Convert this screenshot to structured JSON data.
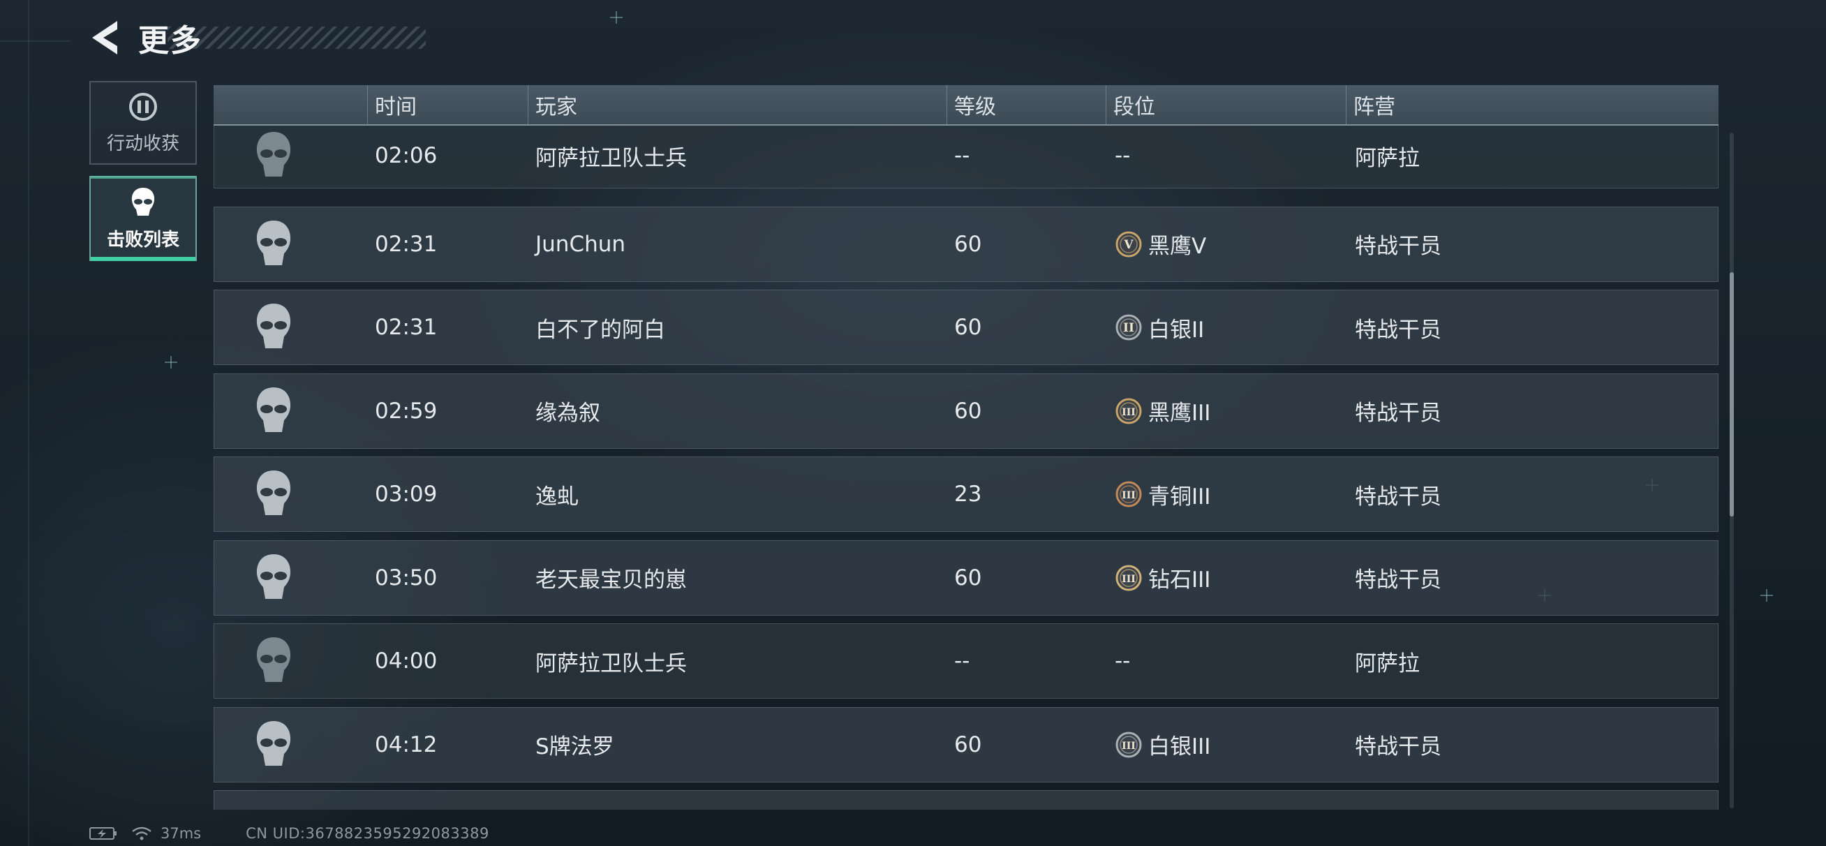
{
  "header": {
    "title": "更多",
    "back_icon": "back-arrow-icon"
  },
  "sidebar": {
    "tabs": [
      {
        "label": "行动收获",
        "icon": "pause-circle-icon",
        "selected": false
      },
      {
        "label": "击败列表",
        "icon": "skull-icon",
        "selected": true
      }
    ]
  },
  "table": {
    "columns": [
      "时间",
      "玩家",
      "等级",
      "段位",
      "阵营"
    ],
    "rows": [
      {
        "time": "02:06",
        "player": "阿萨拉卫队士兵",
        "level": "--",
        "rank": "--",
        "faction": "阿萨拉",
        "npc": true
      },
      {
        "time": "02:31",
        "player": "JunChun",
        "level": "60",
        "rank": "黑鹰V",
        "rank_icon": "V",
        "rank_color": "#c9a56a",
        "faction": "特战干员"
      },
      {
        "time": "02:31",
        "player": "白不了的阿白",
        "level": "60",
        "rank": "白银II",
        "rank_icon": "II",
        "rank_color": "#a9b1b6",
        "faction": "特战干员"
      },
      {
        "time": "02:59",
        "player": "缘為叙",
        "level": "60",
        "rank": "黑鹰III",
        "rank_icon": "III",
        "rank_color": "#c9a56a",
        "faction": "特战干员"
      },
      {
        "time": "03:09",
        "player": "逸虬",
        "level": "23",
        "rank": "青铜III",
        "rank_icon": "III",
        "rank_color": "#c28a5a",
        "faction": "特战干员"
      },
      {
        "time": "03:50",
        "player": "老天最宝贝的崽",
        "level": "60",
        "rank": "钻石III",
        "rank_icon": "III",
        "rank_color": "#d0b27a",
        "faction": "特战干员"
      },
      {
        "time": "04:00",
        "player": "阿萨拉卫队士兵",
        "level": "--",
        "rank": "--",
        "faction": "阿萨拉",
        "npc": true
      },
      {
        "time": "04:12",
        "player": "S牌法罗",
        "level": "60",
        "rank": "白银III",
        "rank_icon": "III",
        "rank_color": "#a9b1b6",
        "faction": "特战干员"
      }
    ]
  },
  "status_bar": {
    "ping": "37ms",
    "uid": "CN UID:3678823595292083389"
  },
  "colors": {
    "accent": "#3fd0a3",
    "row_bg": "#34404a",
    "header_bg": "#44535e"
  }
}
